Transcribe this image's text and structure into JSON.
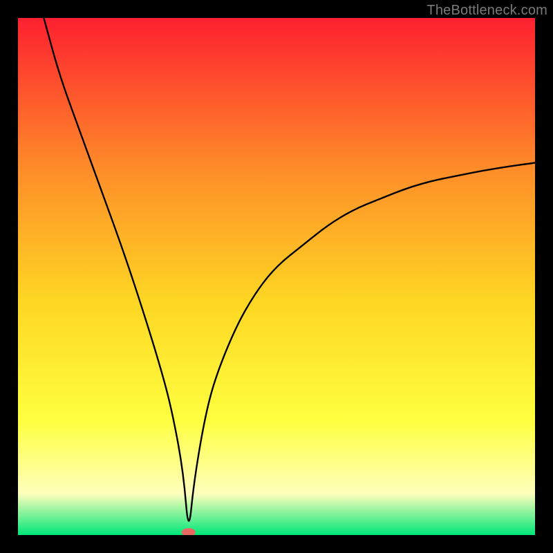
{
  "watermark": "TheBottleneck.com",
  "colors": {
    "gradient_top": "#fe2030",
    "gradient_mid_upper": "#fe8f29",
    "gradient_mid": "#fed723",
    "gradient_mid_lower": "#feff40",
    "gradient_pale": "#feffbc",
    "gradient_bottom": "#00e678",
    "curve": "#000000",
    "marker": "#e66a62",
    "frame": "#000000"
  },
  "chart_data": {
    "type": "line",
    "title": "",
    "xlabel": "",
    "ylabel": "",
    "xlim": [
      0,
      100
    ],
    "ylim": [
      0,
      100
    ],
    "notch_x": 33,
    "left_start": {
      "x": 5,
      "y_pct": 100
    },
    "right_end": {
      "x": 100,
      "y_pct": 72
    },
    "series": [
      {
        "name": "bottleneck-curve",
        "x": [
          5,
          8,
          12,
          16,
          20,
          24,
          28,
          30,
          32,
          33,
          34,
          36,
          38,
          42,
          46,
          50,
          55,
          60,
          65,
          70,
          75,
          80,
          85,
          90,
          95,
          100
        ],
        "y_pct": [
          100,
          89,
          78,
          67,
          56,
          44,
          31,
          23,
          12,
          0,
          10,
          22,
          30,
          40,
          47,
          52,
          56,
          60,
          63,
          65,
          67,
          68.5,
          69.5,
          70.5,
          71.3,
          72
        ]
      }
    ],
    "marker": {
      "x": 33,
      "y_pct": 0,
      "name": "current-config-marker"
    }
  }
}
